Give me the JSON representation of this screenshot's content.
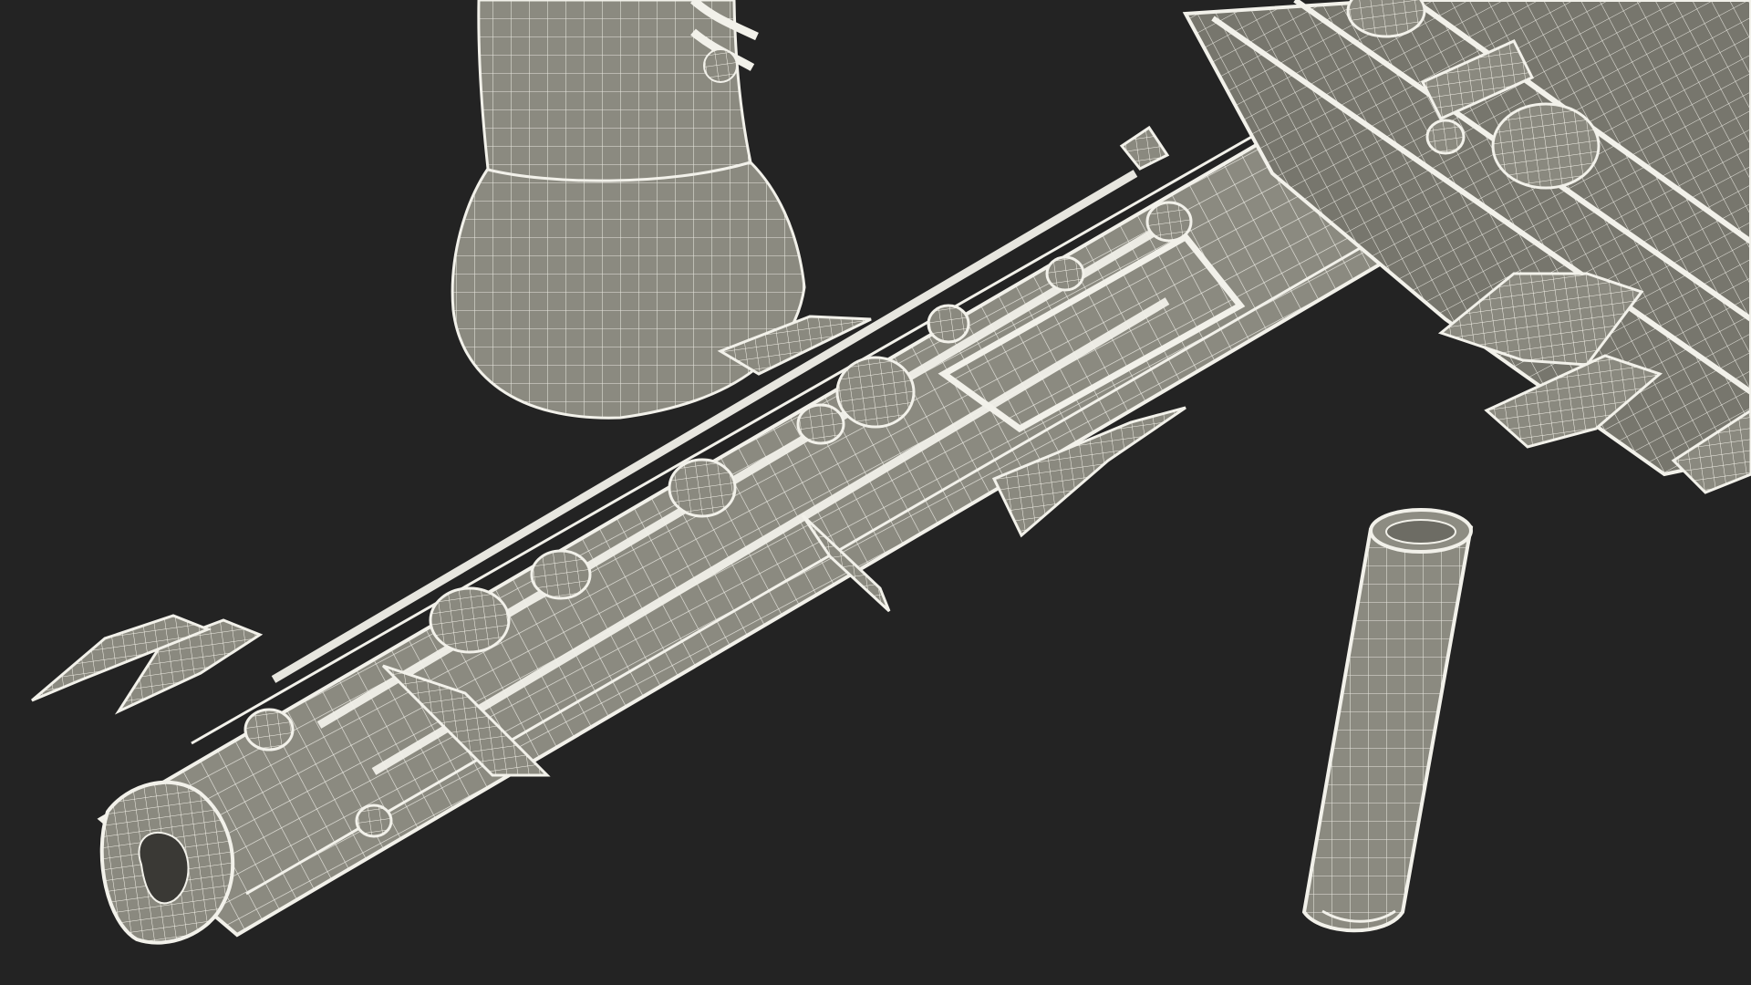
{
  "scene": {
    "background_color": "#232323",
    "model_color": "#8b8a80",
    "model_shadow_color": "#5f5f58",
    "wire_color": "#f2f1ea",
    "objects": [
      "clarinet-body",
      "clarinet-bell",
      "clarinet-upper-joint",
      "clarinet-barrel-tube"
    ]
  }
}
